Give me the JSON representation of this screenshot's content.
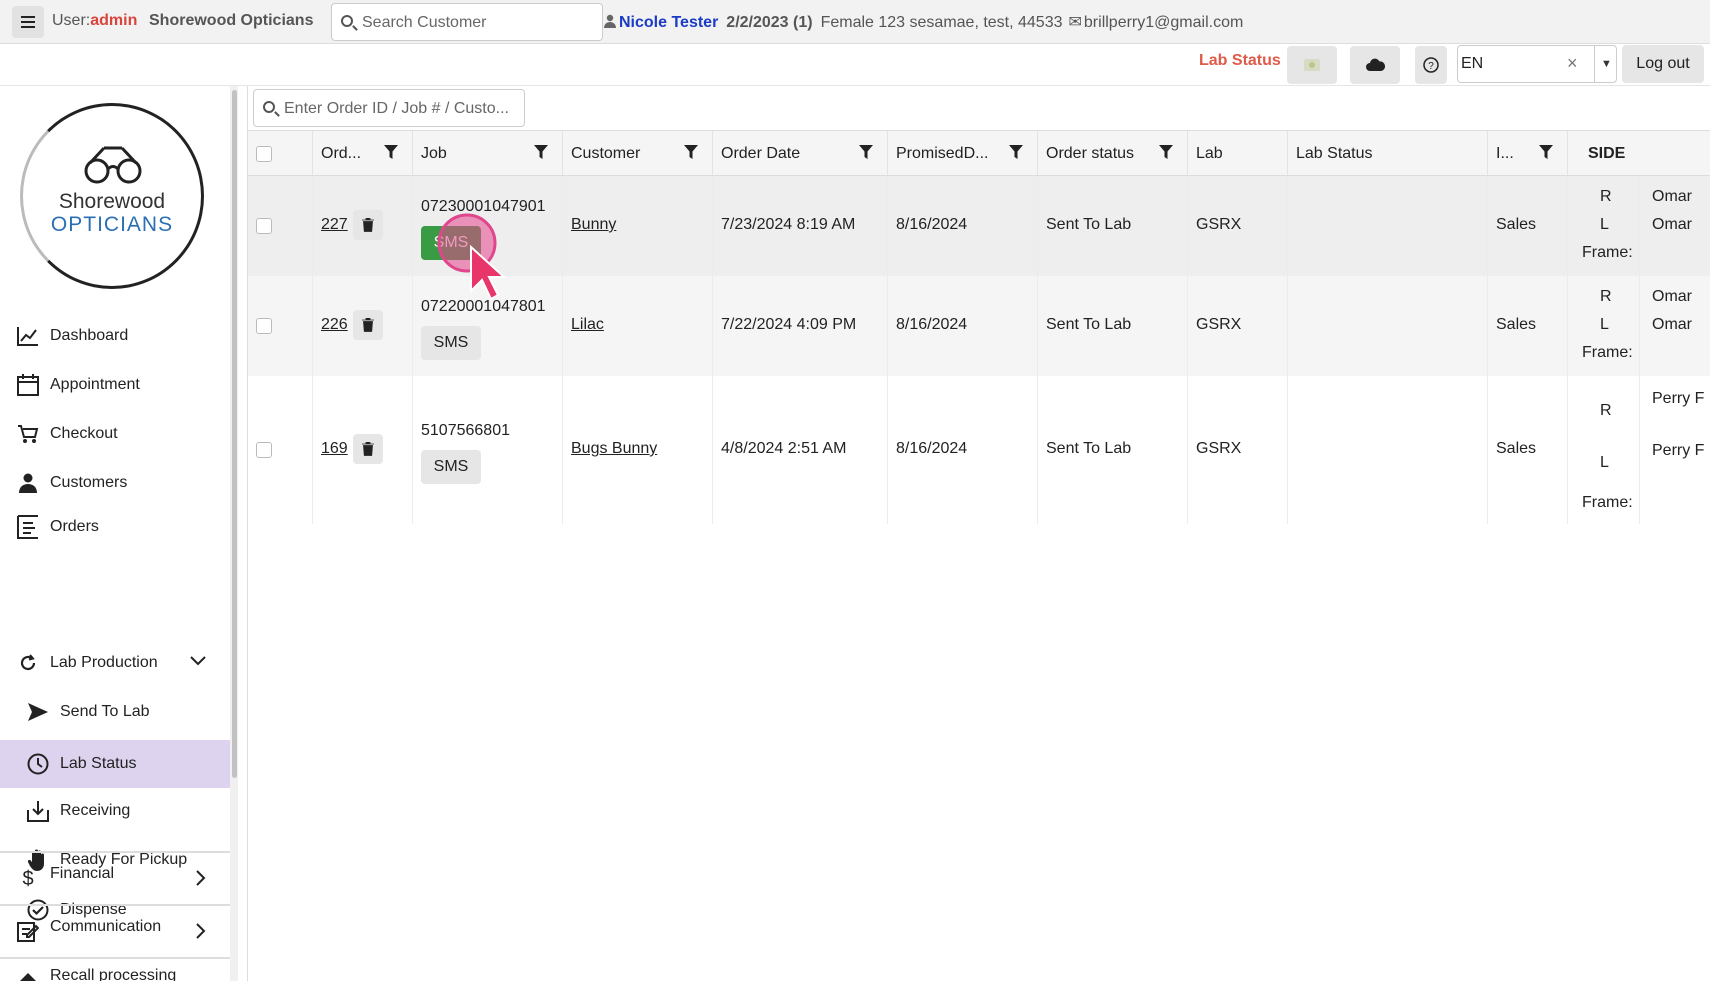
{
  "topbar": {
    "user_prefix": "User:",
    "user_name": "admin",
    "store_name": "Shorewood Opticians",
    "search_placeholder": "Search Customer",
    "patient_name": "Nicole Tester",
    "patient_dob": "2/2/2023 (1)",
    "patient_info": "Female  123 sesamae, test, 44533",
    "patient_email": "brillperry1@gmail.com"
  },
  "toolbar": {
    "lab_status_label": "Lab Status",
    "language": "EN",
    "logout_label": "Log out"
  },
  "logo": {
    "line1": "Shorewood",
    "line2": "OPTICIANS"
  },
  "sidebar": {
    "items": [
      {
        "label": "Dashboard"
      },
      {
        "label": "Appointment"
      },
      {
        "label": "Checkout"
      },
      {
        "label": "Customers"
      },
      {
        "label": "Orders"
      },
      {
        "label": "Lab Production"
      },
      {
        "label": "Send To Lab"
      },
      {
        "label": "Lab Status"
      },
      {
        "label": "Receiving"
      },
      {
        "label": "Ready For Pickup"
      },
      {
        "label": "Dispense"
      },
      {
        "label": "Financial"
      },
      {
        "label": "Communication"
      },
      {
        "label": "Recall processing"
      }
    ]
  },
  "main": {
    "search_placeholder": "Enter Order ID / Job # / Custo...",
    "columns": [
      "Ord...",
      "Job",
      "Customer",
      "Order Date",
      "PromisedD...",
      "Order status",
      "Lab",
      "Lab Status",
      "I...",
      "SIDE"
    ],
    "sms_label": "SMS",
    "side_labels": {
      "r": "R",
      "l": "L",
      "frame": "Frame:"
    },
    "rows": [
      {
        "order": "227",
        "job": "07230001047901",
        "customer": "Bunny",
        "order_date": "7/23/2024 8:19 AM",
        "promised": "8/16/2024",
        "status": "Sent To Lab",
        "lab": "GSRX",
        "lab_status": "",
        "i": "Sales",
        "side_r": "Omar",
        "side_l": "Omar"
      },
      {
        "order": "226",
        "job": "07220001047801",
        "customer": "Lilac",
        "order_date": "7/22/2024 4:09 PM",
        "promised": "8/16/2024",
        "status": "Sent To Lab",
        "lab": "GSRX",
        "lab_status": "",
        "i": "Sales",
        "side_r": "Omar",
        "side_l": "Omar"
      },
      {
        "order": "169",
        "job": "5107566801",
        "customer": "Bugs Bunny",
        "order_date": "4/8/2024 2:51 AM",
        "promised": "8/16/2024",
        "status": "Sent To Lab",
        "lab": "GSRX",
        "lab_status": "",
        "i": "Sales",
        "side_r": "Perry F",
        "side_l": "Perry F"
      }
    ]
  }
}
